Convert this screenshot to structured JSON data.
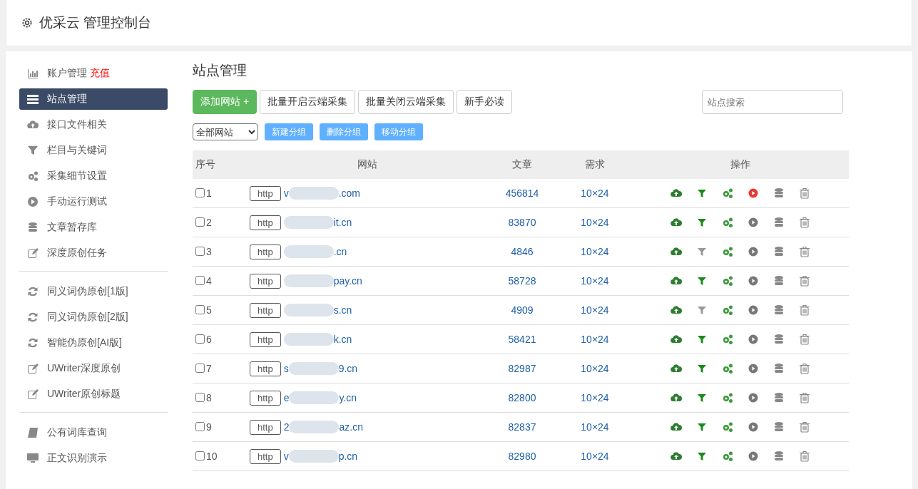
{
  "header": {
    "title": "优采云 管理控制台"
  },
  "sidebar": {
    "groups": [
      [
        {
          "label": "账户管理",
          "badge": "充值",
          "selected": false
        },
        {
          "label": "站点管理",
          "selected": true
        },
        {
          "label": "接口文件相关",
          "selected": false
        },
        {
          "label": "栏目与关键词",
          "selected": false
        },
        {
          "label": "采集细节设置",
          "selected": false
        },
        {
          "label": "手动运行测试",
          "selected": false
        },
        {
          "label": "文章暂存库",
          "selected": false
        },
        {
          "label": "深度原创任务",
          "selected": false
        }
      ],
      [
        {
          "label": "同义词伪原创[1版]",
          "selected": false
        },
        {
          "label": "同义词伪原创[2版]",
          "selected": false
        },
        {
          "label": "智能伪原创[AI版]",
          "selected": false
        },
        {
          "label": "UWriter深度原创",
          "selected": false
        },
        {
          "label": "UWriter原创标题",
          "selected": false
        }
      ],
      [
        {
          "label": "公有词库查询",
          "selected": false
        },
        {
          "label": "正文识别演示",
          "selected": false
        }
      ]
    ]
  },
  "main": {
    "title": "站点管理",
    "buttons": [
      {
        "label": "添加网站 +",
        "kind": "primary"
      },
      {
        "label": "批量开启云端采集",
        "kind": "default"
      },
      {
        "label": "批量关闭云端采集",
        "kind": "default"
      },
      {
        "label": "新手必读",
        "kind": "default"
      }
    ],
    "search": {
      "placeholder": "站点搜索"
    },
    "group_select": {
      "value": "全部网站"
    },
    "group_buttons": [
      "新建分组",
      "删除分组",
      "移动分组"
    ],
    "table": {
      "columns": [
        "序号",
        "网站",
        "文章",
        "需求",
        "操作"
      ],
      "rows": [
        {
          "index": "1",
          "checked": false,
          "protocol": "http",
          "domain_start": "v",
          "domain_end": ".com",
          "articles": "456814",
          "demand": "10×24",
          "filter_on": true,
          "running": true
        },
        {
          "index": "2",
          "checked": false,
          "protocol": "http",
          "domain_start": "",
          "domain_end": "it.cn",
          "articles": "83870",
          "demand": "10×24",
          "filter_on": true,
          "running": false
        },
        {
          "index": "3",
          "checked": false,
          "protocol": "http",
          "domain_start": "",
          "domain_end": ".cn",
          "articles": "4846",
          "demand": "10×24",
          "filter_on": false,
          "running": false
        },
        {
          "index": "4",
          "checked": false,
          "protocol": "http",
          "domain_start": "",
          "domain_end": "pay.cn",
          "articles": "58728",
          "demand": "10×24",
          "filter_on": true,
          "running": false
        },
        {
          "index": "5",
          "checked": false,
          "protocol": "http",
          "domain_start": "",
          "domain_end": "s.cn",
          "articles": "4909",
          "demand": "10×24",
          "filter_on": false,
          "running": false
        },
        {
          "index": "6",
          "checked": false,
          "protocol": "http",
          "domain_start": "",
          "domain_end": "k.cn",
          "articles": "58421",
          "demand": "10×24",
          "filter_on": true,
          "running": false
        },
        {
          "index": "7",
          "checked": false,
          "protocol": "http",
          "domain_start": "s",
          "domain_end": "9.cn",
          "articles": "82987",
          "demand": "10×24",
          "filter_on": true,
          "running": false
        },
        {
          "index": "8",
          "checked": false,
          "protocol": "http",
          "domain_start": "e",
          "domain_end": "y.cn",
          "articles": "82800",
          "demand": "10×24",
          "filter_on": true,
          "running": false
        },
        {
          "index": "9",
          "checked": false,
          "protocol": "http",
          "domain_start": "2",
          "domain_end": "az.cn",
          "articles": "82837",
          "demand": "10×24",
          "filter_on": true,
          "running": false
        },
        {
          "index": "10",
          "checked": false,
          "protocol": "http",
          "domain_start": "v",
          "domain_end": "p.cn",
          "articles": "82980",
          "demand": "10×24",
          "filter_on": true,
          "running": false
        }
      ]
    }
  }
}
